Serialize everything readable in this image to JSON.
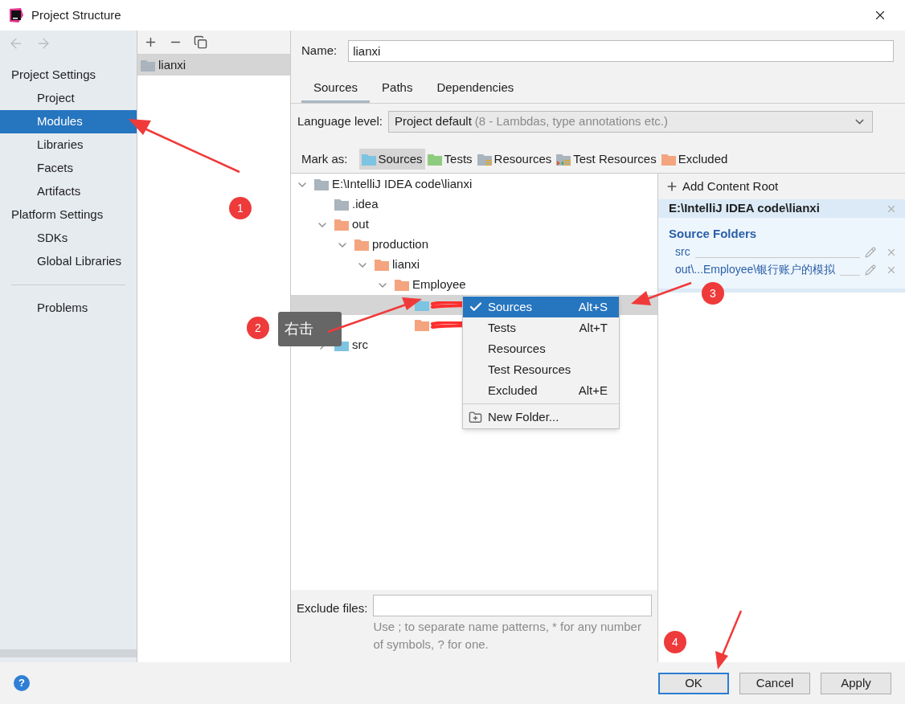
{
  "window": {
    "title": "Project Structure"
  },
  "sidebar": {
    "sections": [
      {
        "heading": "Project Settings",
        "items": [
          {
            "label": "Project",
            "selected": false
          },
          {
            "label": "Modules",
            "selected": true
          },
          {
            "label": "Libraries",
            "selected": false
          },
          {
            "label": "Facets",
            "selected": false
          },
          {
            "label": "Artifacts",
            "selected": false
          }
        ]
      },
      {
        "heading": "Platform Settings",
        "items": [
          {
            "label": "SDKs",
            "selected": false
          },
          {
            "label": "Global Libraries",
            "selected": false
          }
        ]
      }
    ],
    "bottom_items": [
      {
        "label": "Problems",
        "selected": false
      }
    ]
  },
  "modules": [
    {
      "name": "lianxi",
      "selected": true
    }
  ],
  "name_field": {
    "label": "Name:",
    "value": "lianxi"
  },
  "tabs": [
    {
      "label": "Sources",
      "selected": true
    },
    {
      "label": "Paths",
      "selected": false
    },
    {
      "label": "Dependencies",
      "selected": false
    }
  ],
  "language_level": {
    "label": "Language level:",
    "value": "Project default",
    "hint": "(8 - Lambdas, type annotations etc.)"
  },
  "mark_as": {
    "label": "Mark as:",
    "options": [
      {
        "label": "Sources",
        "kind": "source",
        "selected": true
      },
      {
        "label": "Tests",
        "kind": "test",
        "selected": false
      },
      {
        "label": "Resources",
        "kind": "resource",
        "selected": false
      },
      {
        "label": "Test Resources",
        "kind": "test_resource",
        "selected": false
      },
      {
        "label": "Excluded",
        "kind": "excluded",
        "selected": false
      }
    ]
  },
  "tree": [
    {
      "label": "E:\\IntelliJ IDEA  code\\lianxi",
      "kind": "plain",
      "expanded": true,
      "selected": false,
      "children": [
        {
          "label": ".idea",
          "kind": "plain",
          "selected": false
        },
        {
          "label": "out",
          "kind": "excluded",
          "expanded": true,
          "selected": false,
          "children": [
            {
              "label": "production",
              "kind": "excluded",
              "expanded": true,
              "selected": false,
              "children": [
                {
                  "label": "lianxi",
                  "kind": "excluded",
                  "expanded": true,
                  "selected": false,
                  "children": [
                    {
                      "label": "Employee",
                      "kind": "excluded",
                      "expanded": true,
                      "selected": false,
                      "children": [
                        {
                          "kind": "source",
                          "redacted": true,
                          "selected": true
                        },
                        {
                          "kind": "excluded",
                          "redacted": true,
                          "selected": false
                        }
                      ]
                    }
                  ]
                }
              ]
            }
          ]
        },
        {
          "label": "src",
          "kind": "source",
          "expanded": false,
          "selected": false
        }
      ]
    }
  ],
  "content_root": {
    "add_label": "Add Content Root",
    "path": "E:\\IntelliJ IDEA  code\\lianxi",
    "heading": "Source Folders",
    "folders": [
      "src",
      "out\\...Employee\\银行账户的模拟"
    ]
  },
  "context_menu": {
    "items": [
      {
        "label": "Sources",
        "shortcut": "Alt+S",
        "checked": true,
        "selected": true
      },
      {
        "label": "Tests",
        "shortcut": "Alt+T",
        "checked": false,
        "selected": false
      },
      {
        "label": "Resources",
        "checked": false,
        "selected": false
      },
      {
        "label": "Test Resources",
        "checked": false,
        "selected": false
      },
      {
        "label": "Excluded",
        "shortcut": "Alt+E",
        "checked": false,
        "selected": false
      }
    ],
    "extra": {
      "label": "New Folder..."
    }
  },
  "exclude_files": {
    "label": "Exclude files:",
    "hint": "Use ; to separate name patterns, * for any number of symbols, ? for one."
  },
  "help": "?",
  "buttons": [
    {
      "label": "OK",
      "default": true
    },
    {
      "label": "Cancel",
      "default": false
    },
    {
      "label": "Apply",
      "default": false
    }
  ],
  "annotations": [
    {
      "number": "1"
    },
    {
      "number": "2"
    },
    {
      "number": "3"
    },
    {
      "number": "4"
    }
  ],
  "callout": "右击"
}
